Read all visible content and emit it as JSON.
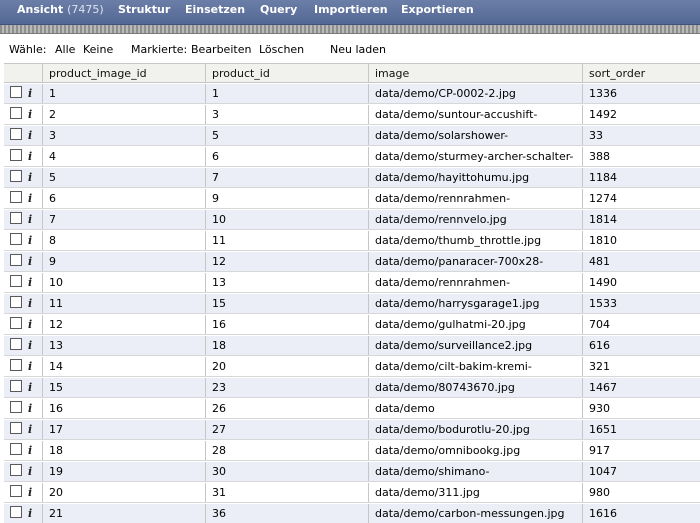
{
  "nav": {
    "tabs": [
      {
        "label": "Ansicht",
        "count": "(7475)"
      },
      {
        "label": "Struktur"
      },
      {
        "label": "Einsetzen"
      },
      {
        "label": "Query"
      },
      {
        "label": "Importieren"
      },
      {
        "label": "Exportieren"
      }
    ]
  },
  "actions": {
    "select_label": "Wähle:",
    "all": "Alle",
    "none": "Keine",
    "marked_label": "Markierte:",
    "edit": "Bearbeiten",
    "delete": "Löschen",
    "reload": "Neu laden"
  },
  "table": {
    "columns": [
      "product_image_id",
      "product_id",
      "image",
      "sort_order"
    ],
    "info_glyph": "i",
    "rows": [
      [
        "1",
        "1",
        "data/demo/CP-0002-2.jpg",
        "1336"
      ],
      [
        "2",
        "3",
        "data/demo/suntour-accushift-",
        "1492"
      ],
      [
        "3",
        "5",
        "data/demo/solarshower-",
        "33"
      ],
      [
        "4",
        "6",
        "data/demo/sturmey-archer-schalter-",
        "388"
      ],
      [
        "5",
        "7",
        "data/demo/hayittohumu.jpg",
        "1184"
      ],
      [
        "6",
        "9",
        "data/demo/rennrahmen-",
        "1274"
      ],
      [
        "7",
        "10",
        "data/demo/rennvelo.jpg",
        "1814"
      ],
      [
        "8",
        "11",
        "data/demo/thumb_throttle.jpg",
        "1810"
      ],
      [
        "9",
        "12",
        "data/demo/panaracer-700x28-",
        "481"
      ],
      [
        "10",
        "13",
        "data/demo/rennrahmen-",
        "1490"
      ],
      [
        "11",
        "15",
        "data/demo/harrysgarage1.jpg",
        "1533"
      ],
      [
        "12",
        "16",
        "data/demo/gulhatmi-20.jpg",
        "704"
      ],
      [
        "13",
        "18",
        "data/demo/surveillance2.jpg",
        "616"
      ],
      [
        "14",
        "20",
        "data/demo/cilt-bakim-kremi-",
        "321"
      ],
      [
        "15",
        "23",
        "data/demo/80743670.jpg",
        "1467"
      ],
      [
        "16",
        "26",
        "data/demo",
        "930"
      ],
      [
        "17",
        "27",
        "data/demo/bodurotlu-20.jpg",
        "1651"
      ],
      [
        "18",
        "28",
        "data/demo/omnibookg.jpg",
        "917"
      ],
      [
        "19",
        "30",
        "data/demo/shimano-",
        "1047"
      ],
      [
        "20",
        "31",
        "data/demo/311.jpg",
        "980"
      ],
      [
        "21",
        "36",
        "data/demo/carbon-messungen.jpg",
        "1616"
      ]
    ]
  }
}
